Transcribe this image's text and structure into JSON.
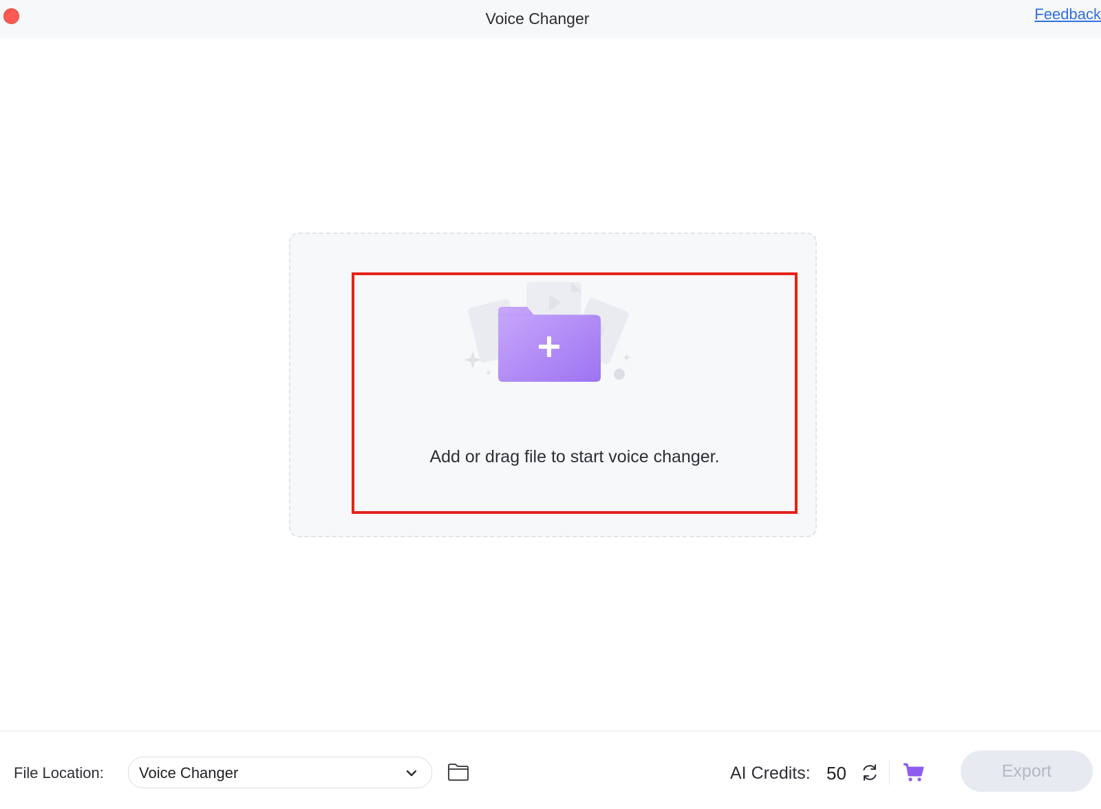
{
  "window": {
    "title": "Voice Changer",
    "feedback_label": "Feedback"
  },
  "drop_zone": {
    "hint": "Add or drag file to start voice changer."
  },
  "footer": {
    "file_location_label": "File Location:",
    "file_location_value": "Voice Changer",
    "credits_label": "AI Credits:",
    "credits_value": "50",
    "export_label": "Export"
  },
  "colors": {
    "close": "#fc5a52",
    "link": "#2f6fe0",
    "highlight": "#e22319",
    "folder": "#a57cf3",
    "cart": "#8f5cf0",
    "export_disabled": "#e7eaf0"
  },
  "icons": [
    "close-button",
    "folder-add-icon",
    "chevron-down-icon",
    "folder-icon",
    "refresh-icon",
    "cart-icon"
  ]
}
